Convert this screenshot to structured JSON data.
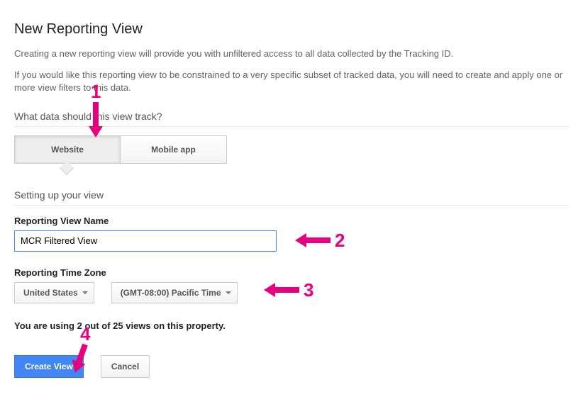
{
  "page": {
    "title": "New Reporting View",
    "desc1": "Creating a new reporting view will provide you with unfiltered access to all data collected by the Tracking ID.",
    "desc2": "If you would like this reporting view to be constrained to a very specific subset of tracked data, you will need to create and apply one or more view filters to this data."
  },
  "track_section": {
    "heading": "What data should this view track?",
    "options": {
      "website": "Website",
      "mobile": "Mobile app"
    }
  },
  "setup_section": {
    "heading": "Setting up your view",
    "name_label": "Reporting View Name",
    "name_value": "MCR Filtered View",
    "tz_label": "Reporting Time Zone",
    "country": "United States",
    "tz": "(GMT-08:00) Pacific Time"
  },
  "usage_note": "You are using 2 out of 25 views on this property.",
  "buttons": {
    "create": "Create View",
    "cancel": "Cancel"
  },
  "annotations": {
    "a1": "1",
    "a2": "2",
    "a3": "3",
    "a4": "4"
  }
}
